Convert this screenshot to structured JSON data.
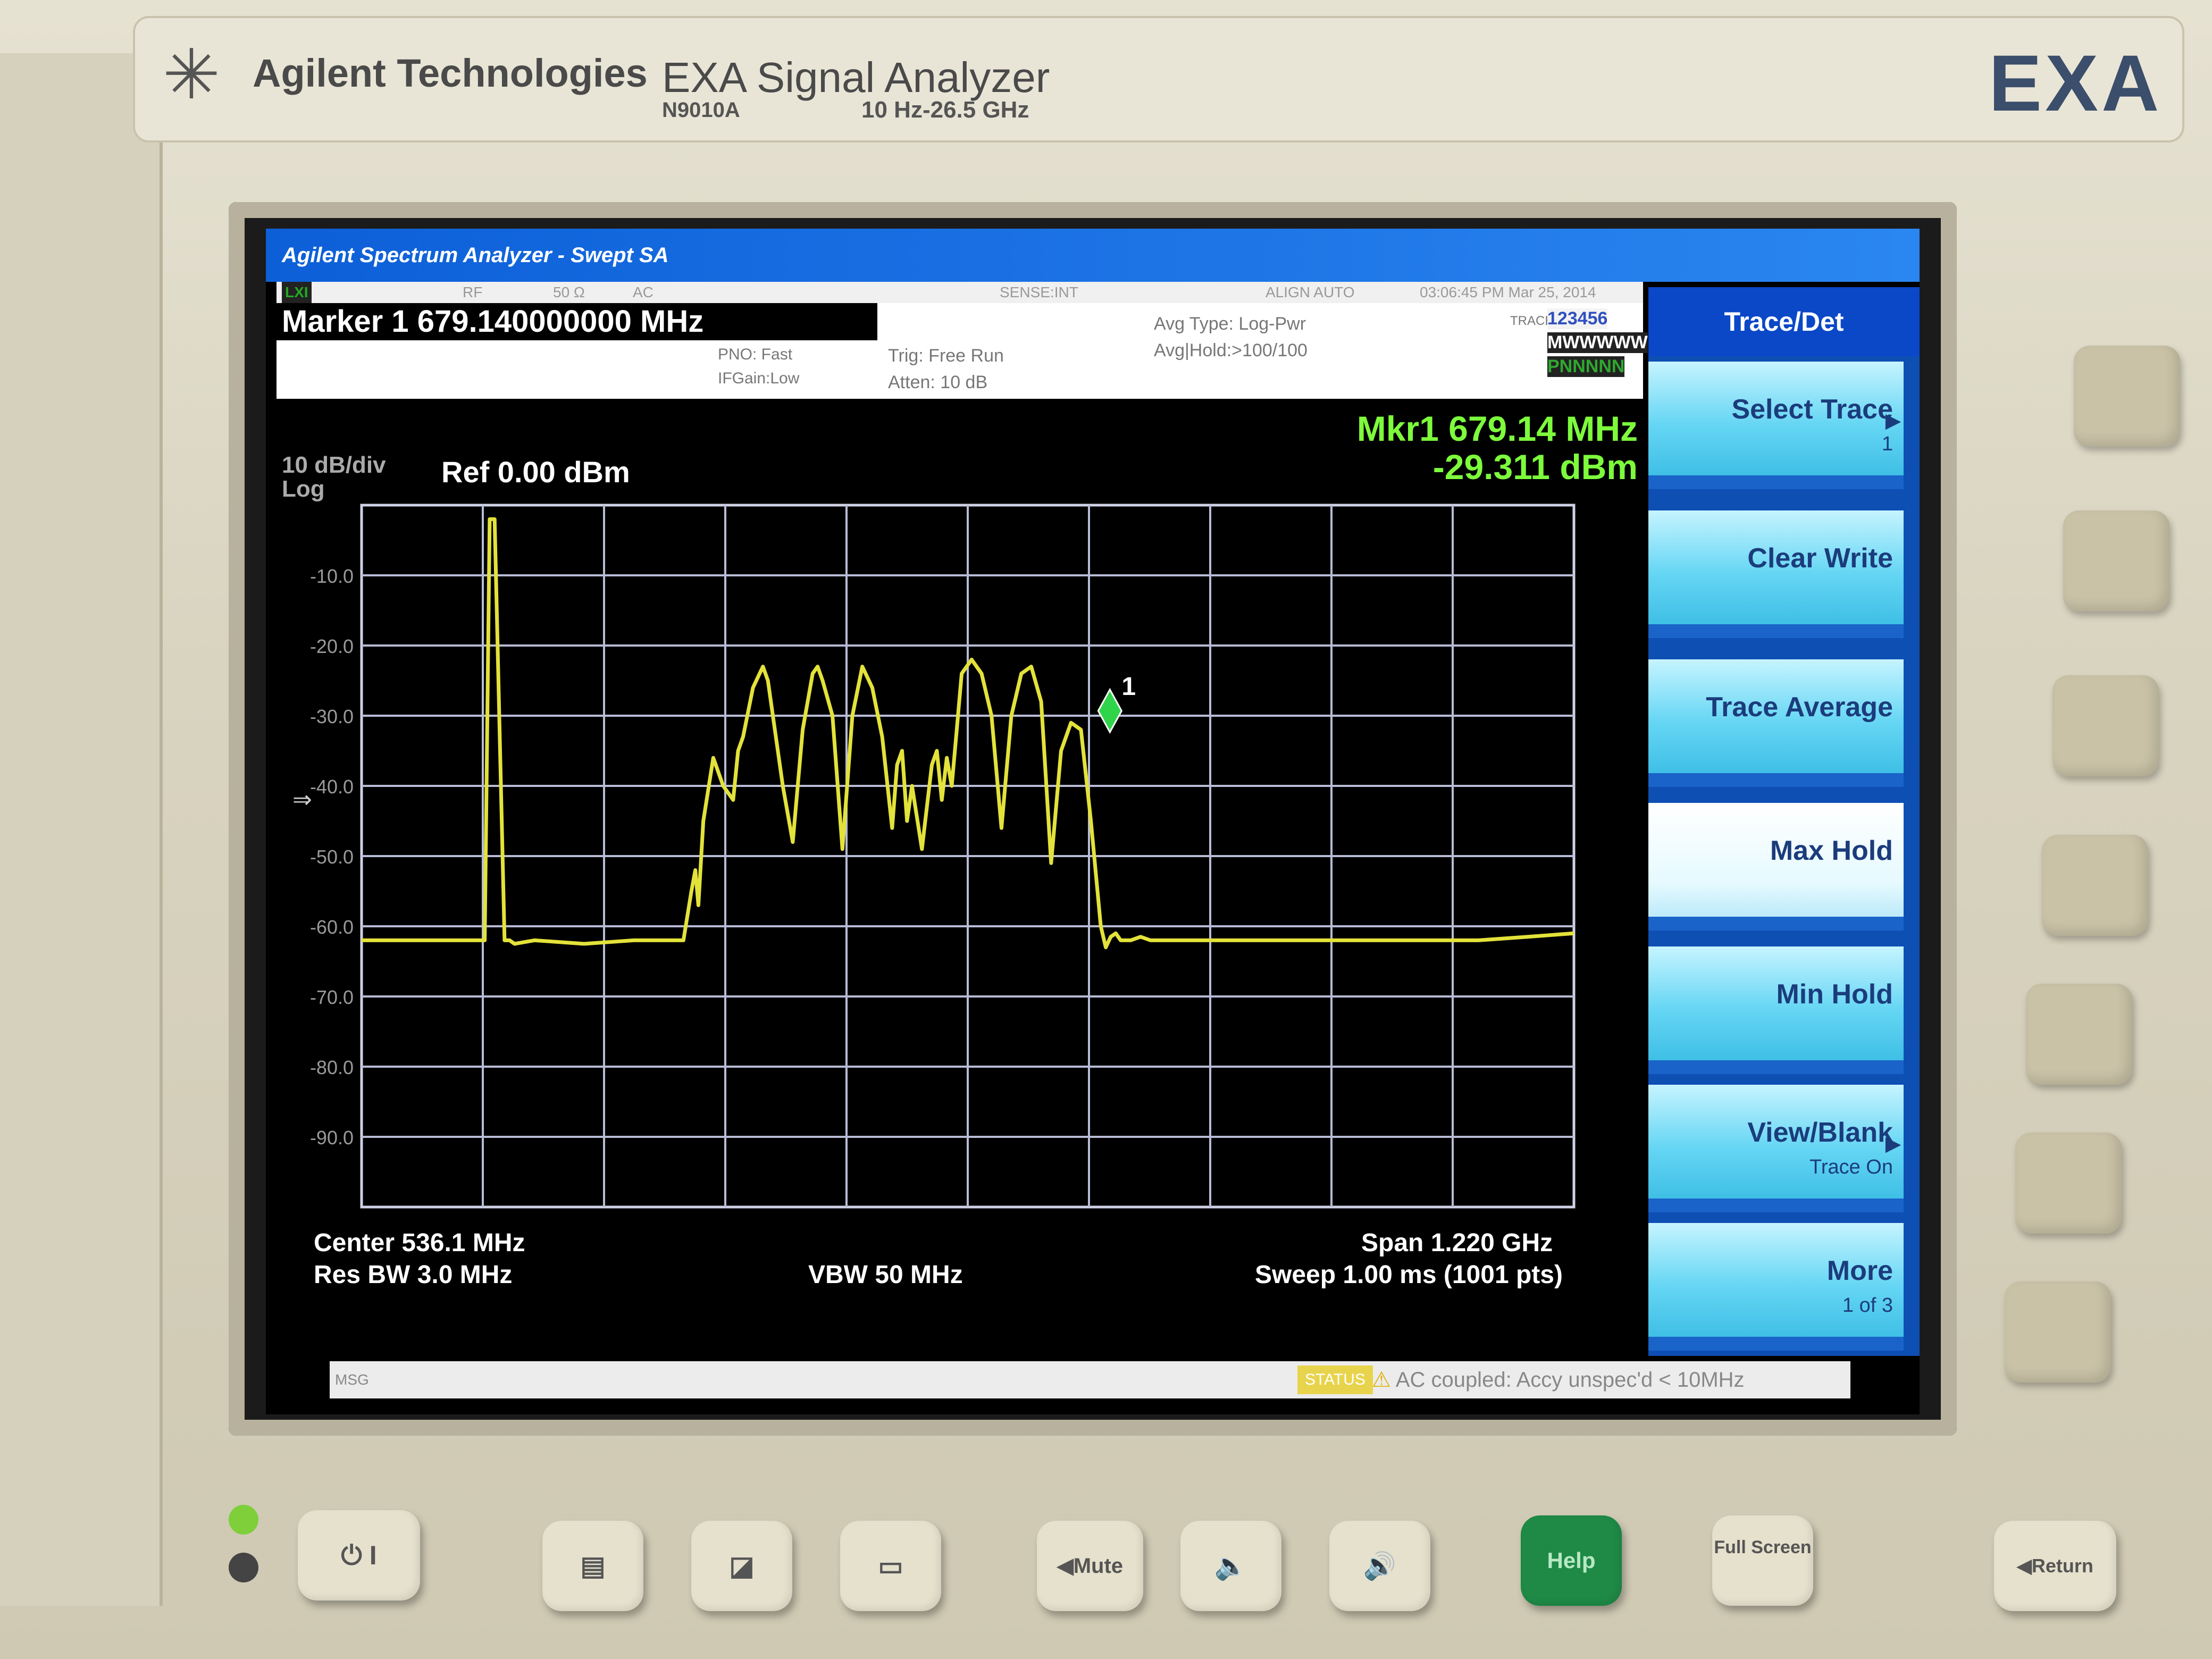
{
  "instrument": {
    "brand": "Agilent Technologies",
    "product": "EXA Signal Analyzer",
    "model": "N9010A",
    "range": "10 Hz-26.5 GHz",
    "logo": "EXA"
  },
  "screen": {
    "title": "Agilent Spectrum Analyzer - Swept SA",
    "status_strip": {
      "lxi": "LXI",
      "rf": "RF",
      "impedance": "50 Ω",
      "coupling": "AC",
      "sense": "SENSE:INT",
      "align": "ALIGN AUTO",
      "time": "03:06:45 PM Mar 25, 2014"
    },
    "marker_line": "Marker 1 679.140000000 MHz",
    "pno": "PNO: Fast",
    "ifgain": "IFGain:Low",
    "trig": "Trig: Free Run",
    "atten": "Atten: 10 dB",
    "avg_type": "Avg Type: Log-Pwr",
    "avg_hold": "Avg|Hold:>100/100",
    "trace_label": "TRACE",
    "trace_numbers": "123456",
    "trace_types": "MWWWWW",
    "trace_detectors": "PNNNNN",
    "mkr_readout": {
      "line1": "Mkr1 679.14 MHz",
      "line2": "-29.311 dBm"
    },
    "scale": "10 dB/div",
    "scale_type": "Log",
    "ref": "Ref 0.00 dBm",
    "center": "Center 536.1 MHz",
    "res_bw": "Res BW 3.0 MHz",
    "vbw": "VBW 50 MHz",
    "span": "Span 1.220 GHz",
    "sweep": "Sweep  1.00 ms (1001 pts)",
    "msg_label": "MSG",
    "status_label": "STATUS",
    "status_msg": "AC coupled: Accy unspec'd < 10MHz",
    "marker_number": "1"
  },
  "softkeys": {
    "title": "Trace/Det",
    "keys": [
      {
        "label": "Select Trace",
        "sub": "1"
      },
      {
        "label": "Clear Write",
        "sub": ""
      },
      {
        "label": "Trace Average",
        "sub": ""
      },
      {
        "label": "Max Hold",
        "sub": ""
      },
      {
        "label": "Min Hold",
        "sub": ""
      },
      {
        "label": "View/Blank",
        "sub": "Trace On"
      },
      {
        "label": "More",
        "sub": "1 of 3"
      }
    ]
  },
  "hw_buttons": {
    "power": "⏻ I",
    "mute": "◀Mute",
    "help": "Help",
    "full_screen": "Full Screen",
    "return": "◀Return"
  },
  "chart_data": {
    "type": "line",
    "title": "",
    "xlabel": "",
    "ylabel": "",
    "xlim": [
      -73.9,
      1146.1
    ],
    "ylim": [
      -100,
      0
    ],
    "x_unit": "MHz",
    "y_unit": "dBm",
    "y_ticks": [
      -10,
      -20,
      -30,
      -40,
      -50,
      -60,
      -70,
      -80,
      -90
    ],
    "y_tick_labels": [
      "-10.0",
      "-20.0",
      "-30.0",
      "-40.0",
      "-50.0",
      "-60.0",
      "-70.0",
      "-80.0",
      "-90.0"
    ],
    "grid": true,
    "series": [
      {
        "color": "#e3e23a",
        "x": [
          -73.9,
          0,
          50,
          55,
          60,
          70,
          75,
          80,
          100,
          150,
          200,
          250,
          258,
          262,
          265,
          270,
          280,
          290,
          300,
          305,
          310,
          320,
          330,
          335,
          340,
          350,
          360,
          370,
          380,
          385,
          390,
          400,
          410,
          420,
          430,
          440,
          450,
          460,
          465,
          470,
          475,
          480,
          490,
          500,
          505,
          510,
          515,
          520,
          525,
          530,
          540,
          550,
          560,
          570,
          580,
          585,
          590,
          600,
          610,
          620,
          630,
          640,
          650,
          660,
          670,
          675,
          680,
          685,
          690,
          700,
          710,
          720,
          730,
          740,
          750,
          760,
          770,
          780,
          790,
          800,
          810,
          820,
          830,
          835,
          840,
          845,
          850,
          860,
          870,
          880,
          900,
          950,
          1000,
          1050,
          1100,
          1146.1
        ],
        "y": [
          -62,
          -62,
          -62,
          -2,
          -2,
          -62,
          -62,
          -62.5,
          -62,
          -62.5,
          -62,
          -62,
          -55,
          -52,
          -57,
          -45,
          -36,
          -40,
          -42,
          -35,
          -33,
          -26,
          -23,
          -25,
          -30,
          -40,
          -48,
          -32,
          -24,
          -23,
          -25,
          -30,
          -49,
          -30,
          -23,
          -26,
          -33,
          -46,
          -37,
          -35,
          -45,
          -40,
          -49,
          -37,
          -35,
          -42,
          -36,
          -40,
          -32,
          -24,
          -22,
          -24,
          -30,
          -46,
          -30,
          -27,
          -24,
          -23,
          -28,
          -51,
          -35,
          -31,
          -32,
          -45,
          -60,
          -63,
          -61.5,
          -61,
          -62,
          -62,
          -61.5,
          -62,
          -62,
          -62,
          -62,
          -62,
          -62,
          -62,
          -62,
          -62,
          -62,
          -62,
          -62,
          -62,
          -62,
          -62,
          -62,
          -62,
          -62,
          -62,
          -62,
          -62,
          -62,
          -62,
          -61.5,
          -61
        ]
      }
    ],
    "marker": {
      "label": "1",
      "x": 679.14,
      "y": -29.311
    }
  }
}
